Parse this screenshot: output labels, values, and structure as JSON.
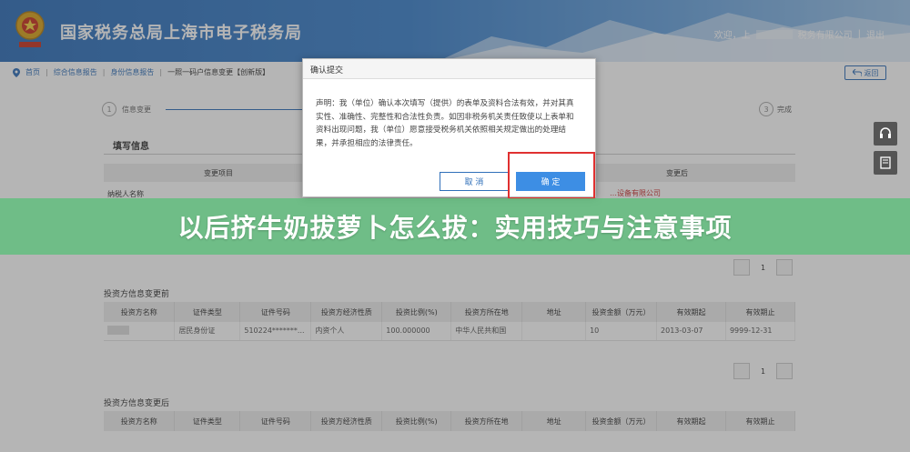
{
  "header": {
    "site_title": "国家税务总局上海市电子税务局",
    "user_prefix": "欢迎，上",
    "user_suffix": "税务有限公司",
    "sep": "|",
    "logout": "退出"
  },
  "breadcrumb": {
    "items": [
      "首页",
      "综合信息报告",
      "身份信息报告",
      "一照一码户信息变更【创新版】"
    ],
    "back_label": "返回"
  },
  "steps": {
    "step1_num": "1",
    "step1_label": "信息变更",
    "step3_num": "3",
    "step3_label": "完成"
  },
  "section_tab": "填写信息",
  "change_table": {
    "head_left": "变更项目",
    "head_right": "变更后",
    "row1_label": "纳税人名称",
    "row1_value": "…设备有限公司"
  },
  "pager": {
    "page": "1"
  },
  "investor_before": {
    "title": "投资方信息变更前",
    "columns": [
      "投资方名称",
      "证件类型",
      "证件号码",
      "投资方经济性质",
      "投资比例(%)",
      "投资方所在地",
      "地址",
      "投资金额（万元）",
      "有效期起",
      "有效期止"
    ],
    "row": [
      "",
      "居民身份证",
      "510224*******...",
      "内资个人",
      "100.000000",
      "中华人民共和国",
      "",
      "10",
      "2013-03-07",
      "9999-12-31"
    ]
  },
  "investor_after": {
    "title": "投资方信息变更后",
    "columns": [
      "投资方名称",
      "证件类型",
      "证件号码",
      "投资方经济性质",
      "投资比例(%)",
      "投资方所在地",
      "地址",
      "投资金额（万元）",
      "有效期起",
      "有效期止"
    ]
  },
  "dialog": {
    "title": "确认提交",
    "body": "声明：我（单位）确认本次填写（提供）的表单及资料合法有效，并对其真实性、准确性、完整性和合法性负责。如因非税务机关责任致使以上表单和资料出现问题，我（单位）愿意接受税务机关依照相关规定做出的处理结果，并承担相应的法律责任。",
    "cancel": "取 消",
    "ok": "确 定"
  },
  "banner": {
    "text": "以后挤牛奶拔萝卜怎么拔：实用技巧与注意事项"
  }
}
